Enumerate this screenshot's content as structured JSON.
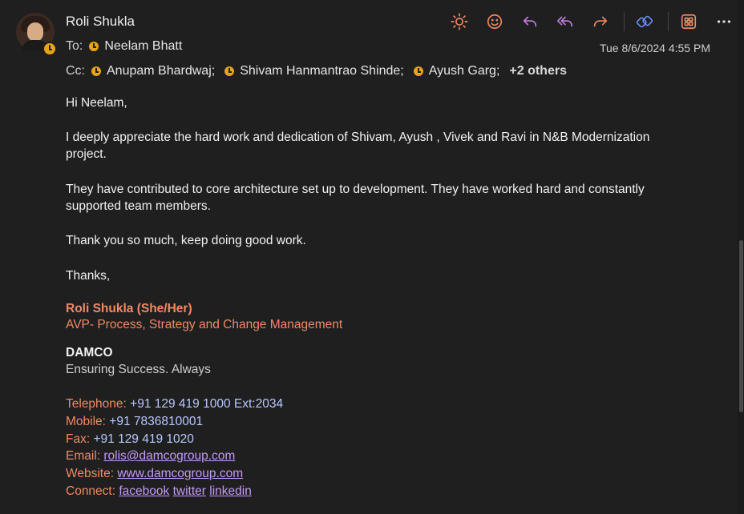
{
  "header": {
    "sender": "Roli Shukla",
    "to_label": "To:",
    "to": [
      "Neelam Bhatt"
    ],
    "cc_label": "Cc:",
    "cc": [
      "Anupam Bhardwaj;",
      "Shivam Hanmantrao Shinde;",
      "Ayush Garg;"
    ],
    "cc_more": "+2 others",
    "date": "Tue 8/6/2024 4:55 PM"
  },
  "toolbar": {
    "icons": [
      "sun-icon",
      "emoji-icon",
      "reply-icon",
      "reply-all-icon",
      "forward-icon",
      "loop-icon",
      "apps-icon",
      "more-icon"
    ],
    "colors": {
      "sun": "#f08a65",
      "emoji": "#f08a65",
      "reply": "#c07fe0",
      "forward": "#f08a65",
      "loop": "#6b8cff"
    }
  },
  "body": {
    "greeting": "Hi Neelam,",
    "p1": "I deeply appreciate the hard work and dedication of Shivam, Ayush , Vivek and Ravi in N&B Modernization project.",
    "p2": "They have contributed to core architecture set up to development. They have worked hard and constantly supported team members.",
    "p3": "Thank you so much, keep doing good work.",
    "closing": "Thanks,"
  },
  "signature": {
    "name": "Roli Shukla (She/Her)",
    "title": "AVP- Process, Strategy and Change Management",
    "company": "DAMCO",
    "tagline": "Ensuring Success. Always",
    "telephone_label": "Telephone:",
    "telephone": "+91 129 419 1000 Ext:2034",
    "mobile_label": "Mobile:",
    "mobile": "+91 7836810001",
    "fax_label": "Fax:",
    "fax": "+91 129 419 1020",
    "email_label": "Email:",
    "email": "rolis@damcogroup.com",
    "website_label": "Website:",
    "website": "www.damcogroup.com",
    "connect_label": "Connect:",
    "connect": [
      "facebook",
      "twitter",
      "linkedin"
    ]
  }
}
